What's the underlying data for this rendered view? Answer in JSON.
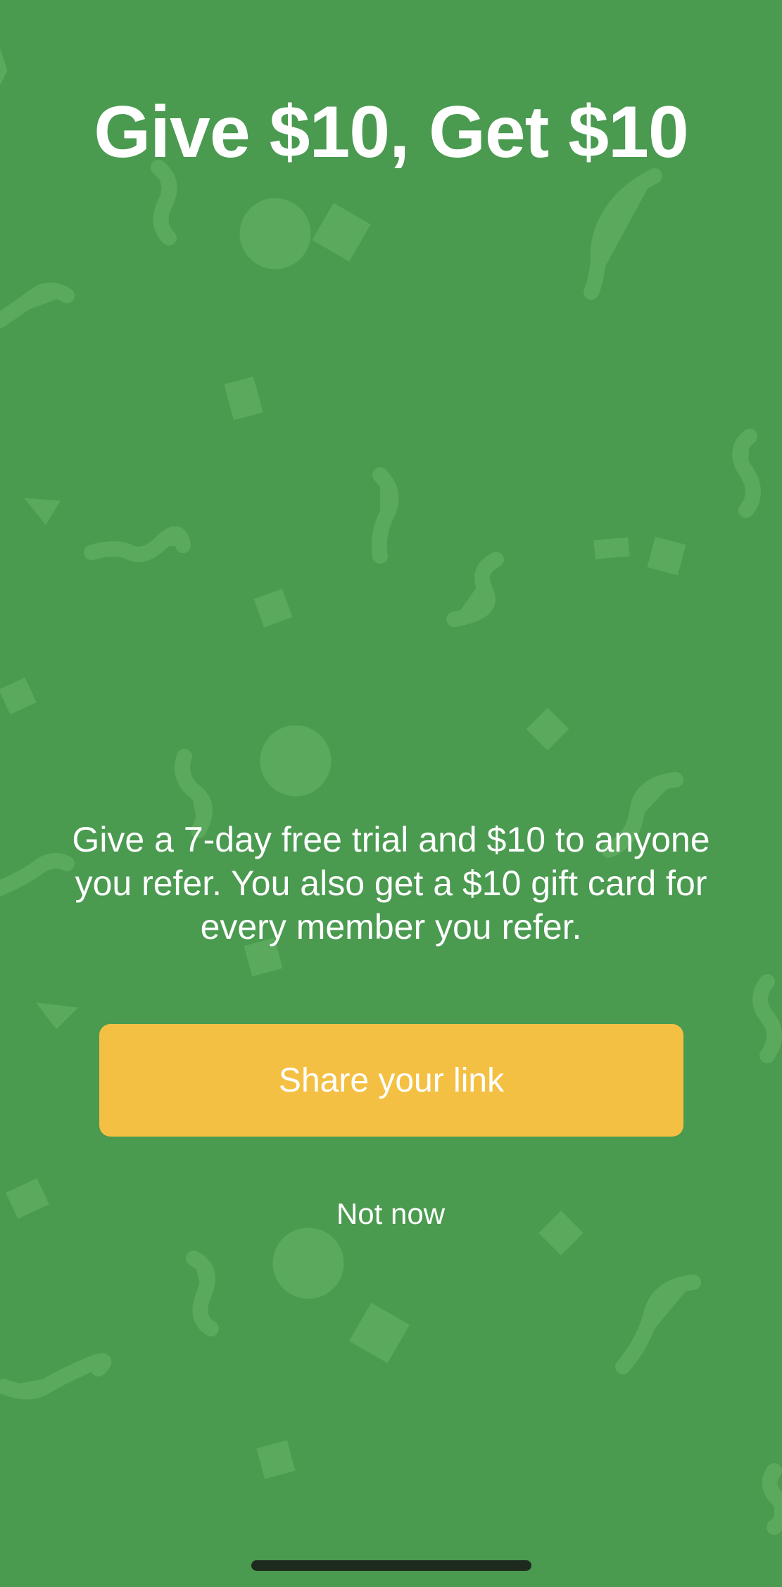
{
  "referral": {
    "headline": "Give $10, Get $10",
    "body": "Give a 7-day free trial and $10 to anyone you refer. You also get a $10 gift card for every member you refer.",
    "share_label": "Share your link",
    "dismiss_label": "Not now"
  },
  "colors": {
    "background": "#4a9a50",
    "confetti": "#5aa95c",
    "button": "#f4c044",
    "text": "#ffffff",
    "home_indicator": "#1e2a1e"
  }
}
